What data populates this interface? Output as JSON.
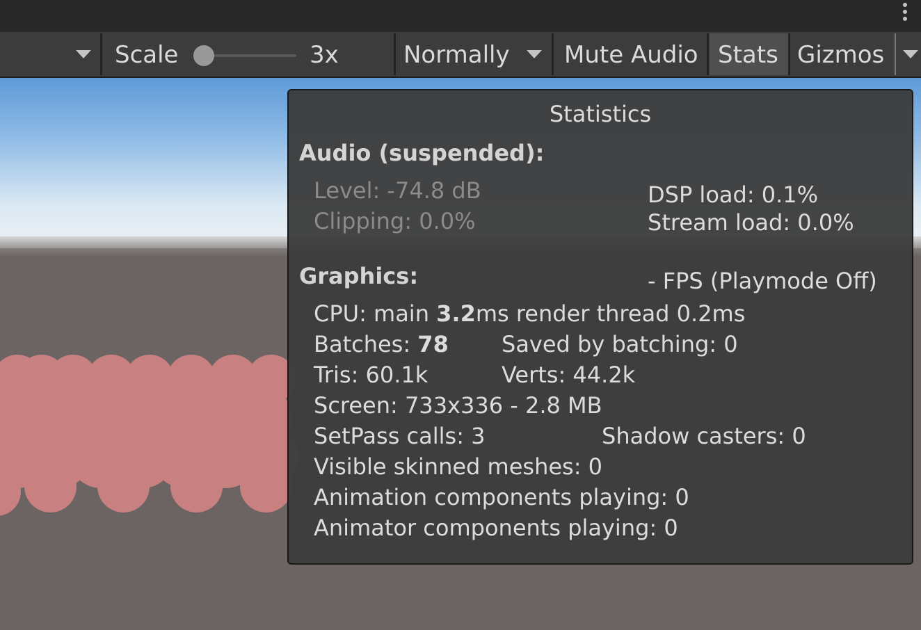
{
  "toolbar": {
    "scale_label": "Scale",
    "scale_value": "3x",
    "scale_slider_level": 0.0,
    "play_mode": "Normally",
    "mute_audio": "Mute Audio",
    "stats": "Stats",
    "gizmos": "Gizmos"
  },
  "stats": {
    "title": "Statistics",
    "audio": {
      "heading": "Audio (suspended):",
      "level": "Level: -74.8 dB",
      "clipping": "Clipping: 0.0%",
      "dsp_load": "DSP load: 0.1%",
      "stream_load": "Stream load: 0.0%"
    },
    "graphics": {
      "heading": "Graphics:",
      "fps": "- FPS (Playmode Off)",
      "cpu_prefix": "CPU: main ",
      "cpu_main": "3.2",
      "cpu_suffix": "ms  render thread 0.2ms",
      "batches_label": "Batches: ",
      "batches_value": "78",
      "saved_by_batching": "Saved by batching: 0",
      "tris": "Tris: 60.1k",
      "verts": "Verts: 44.2k",
      "screen": "Screen: 733x336 - 2.8 MB",
      "setpass": "SetPass calls: 3",
      "shadow_casters": "Shadow casters: 0",
      "skinned_meshes": "Visible skinned meshes: 0",
      "animation_components": "Animation components playing: 0",
      "animator_components": "Animator components playing: 0"
    }
  },
  "colors": {
    "toolbar_bg": "#3c3c3c",
    "panel_bg": "#3c3c3c",
    "blob": "#c88080",
    "ground": "#6b6462"
  }
}
